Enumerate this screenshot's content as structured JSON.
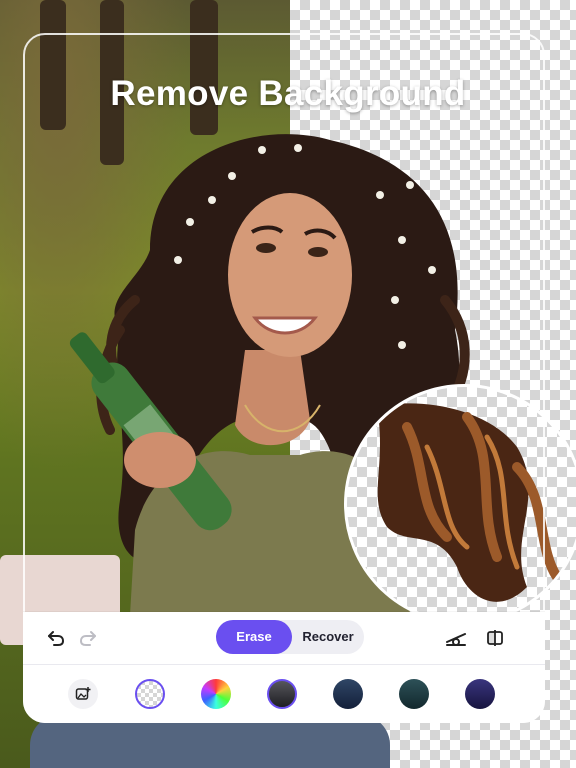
{
  "headline": "Remove Background",
  "toolbar": {
    "undo_icon": "undo-arrow-icon",
    "redo_icon": "redo-arrow-icon",
    "modes": [
      {
        "label": "Erase",
        "active": true
      },
      {
        "label": "Recover",
        "active": false
      }
    ],
    "brush_settings_icon": "brush-size-icon",
    "compare_icon": "compare-split-icon"
  },
  "background_options": [
    {
      "name": "add-image",
      "icon": "add-photo-icon"
    },
    {
      "name": "transparent",
      "selected": true
    },
    {
      "name": "color-wheel"
    },
    {
      "name": "charcoal-gradient",
      "color": "#3a3a3e"
    },
    {
      "name": "navy-gradient",
      "color": "#1f2f48"
    },
    {
      "name": "teal-gradient",
      "color": "#1e3a40"
    },
    {
      "name": "indigo-gradient",
      "color": "#27235e"
    }
  ],
  "colors": {
    "accent": "#6a4ff0",
    "panel": "#ffffff",
    "segment_bg": "#eeeef3"
  }
}
